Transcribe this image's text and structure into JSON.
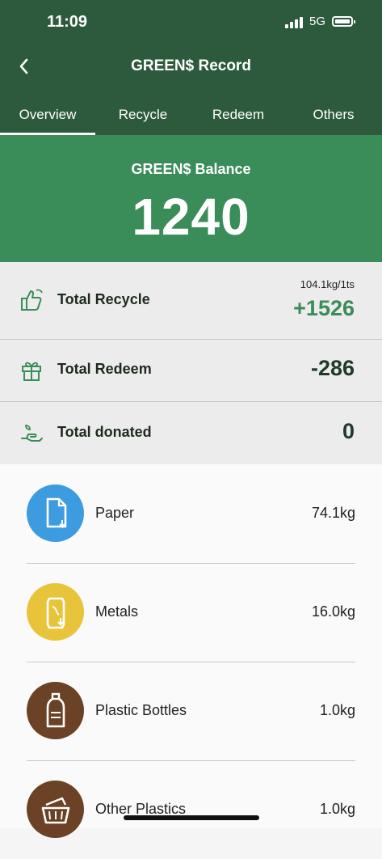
{
  "status_bar": {
    "time": "11:09",
    "network": "5G"
  },
  "header": {
    "back_icon": "chevron-left-icon",
    "title": "GREEN$ Record"
  },
  "tabs": [
    {
      "label": "Overview",
      "active": true
    },
    {
      "label": "Recycle",
      "active": false
    },
    {
      "label": "Redeem",
      "active": false
    },
    {
      "label": "Others",
      "active": false
    }
  ],
  "balance": {
    "label": "GREEN$ Balance",
    "value": "1240"
  },
  "summary": {
    "recycle": {
      "label": "Total Recycle",
      "sub": "104.1kg/1ts",
      "value": "+1526",
      "icon": "thumbs-up-recycle-icon",
      "value_color": "#3a8c58"
    },
    "redeem": {
      "label": "Total Redeem",
      "value": "-286",
      "icon": "gift-icon"
    },
    "donated": {
      "label": "Total donated",
      "value": "0",
      "icon": "donate-hand-icon"
    }
  },
  "materials": [
    {
      "label": "Paper",
      "value": "74.1kg",
      "color": "#3d9be0",
      "icon": "paper-icon"
    },
    {
      "label": "Metals",
      "value": "16.0kg",
      "color": "#e8c43a",
      "icon": "can-icon"
    },
    {
      "label": "Plastic Bottles",
      "value": "1.0kg",
      "color": "#6b4226",
      "icon": "bottle-icon"
    },
    {
      "label": "Other Plastics",
      "value": "1.0kg",
      "color": "#6b4226",
      "icon": "basket-icon"
    }
  ],
  "colors": {
    "header": "#2d5a3c",
    "balance": "#3a8c58",
    "accent_green": "#3a8c58"
  }
}
